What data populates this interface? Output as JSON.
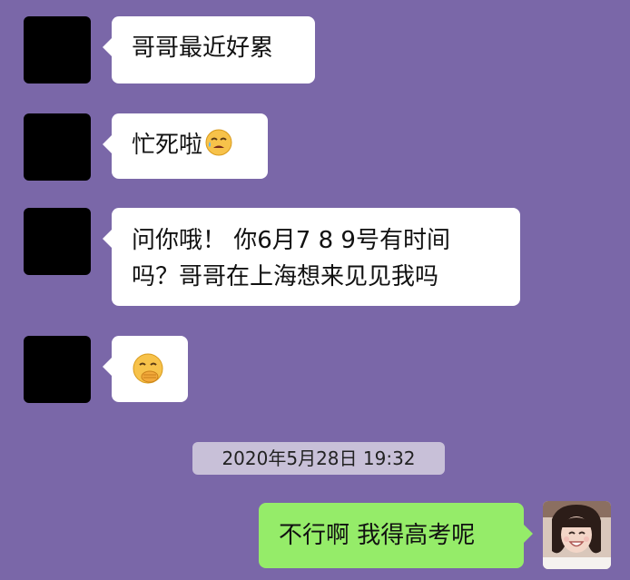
{
  "chat": {
    "messages": [
      {
        "sender": "other",
        "text": "哥哥最近好累"
      },
      {
        "sender": "other",
        "text": "忙死啦",
        "emoji": "tired-face-emoji"
      },
      {
        "sender": "other",
        "line1": "问你哦！ 你6月7 8 9号有时间",
        "line2": "吗？哥哥在上海想来见见我吗"
      },
      {
        "sender": "other",
        "emoji": "hand-over-mouth-emoji"
      }
    ],
    "timestamp": "2020年5月28日 19:32",
    "reply": {
      "sender": "me",
      "text": "不行啊 我得高考呢"
    }
  },
  "colors": {
    "background": "#7a67a8",
    "bubble_other": "#ffffff",
    "bubble_me": "#95ec69",
    "timestamp_bg": "#c8c0d8"
  }
}
